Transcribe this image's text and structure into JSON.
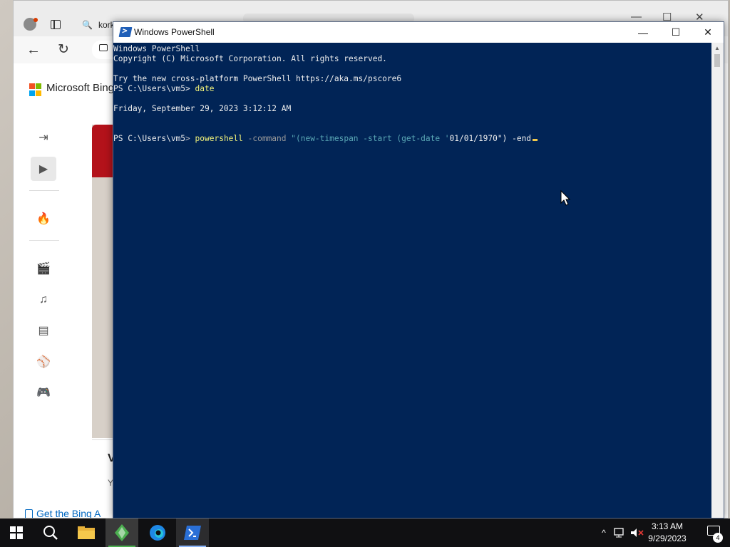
{
  "browser": {
    "tab_text": "kork",
    "brand": "Microsoft Bing",
    "card_title": "V",
    "card_sub": "Y",
    "get_app": "Get the Bing A",
    "controls": {
      "minimize": "—",
      "maximize": "☐",
      "close": "✕"
    }
  },
  "powershell": {
    "title": "Windows PowerShell",
    "controls": {
      "minimize": "—",
      "maximize": "☐",
      "close": "✕"
    },
    "lines": {
      "l1": "Windows PowerShell",
      "l2": "Copyright (C) Microsoft Corporation. All rights reserved.",
      "l4": "Try the new cross-platform PowerShell https://aka.ms/pscore6",
      "prompt": "PS C:\\Users\\vm5",
      "gt": "> ",
      "cmd_date": "date",
      "date_output": "Friday, September 29, 2023 3:12:12 AM",
      "cmd_powershell": "powershell",
      "param_command": " -command ",
      "str_part": "\"(new-timespan -start (get-date '",
      "lit_part": "01/01/1970\") -end",
      "cursor": ""
    }
  },
  "taskbar": {
    "time": "3:13 AM",
    "date": "9/29/2023",
    "notification_count": "4"
  },
  "colors": {
    "console_bg": "#012456",
    "console_text": "#ededed",
    "command_yellow": "#f2f27a",
    "param_gray": "#9a9a9a",
    "string_teal": "#5aa7b5",
    "taskbar_bg": "#101012"
  }
}
